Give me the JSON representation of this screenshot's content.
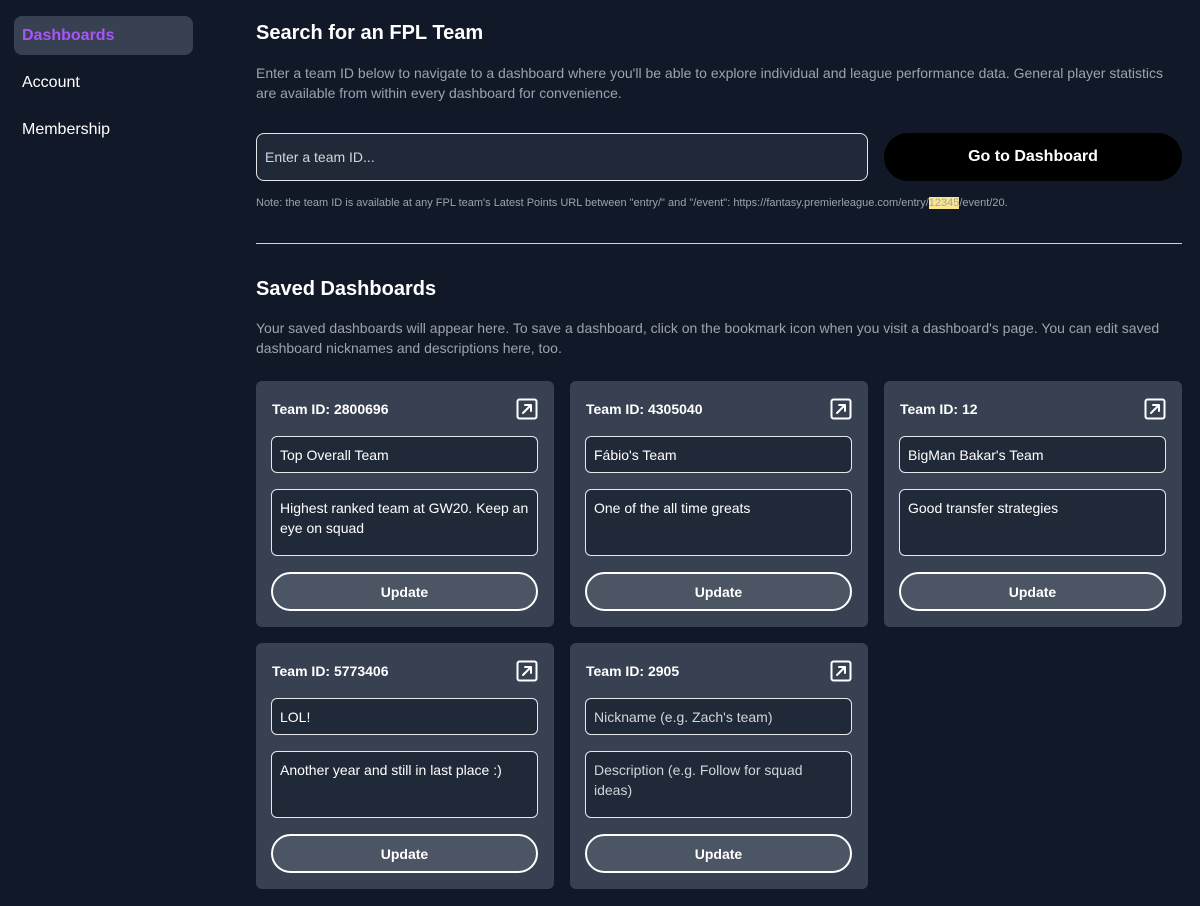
{
  "sidebar": {
    "items": [
      {
        "label": "Dashboards",
        "active": true
      },
      {
        "label": "Account",
        "active": false
      },
      {
        "label": "Membership",
        "active": false
      }
    ]
  },
  "search": {
    "title": "Search for an FPL Team",
    "description": "Enter a team ID below to navigate to a dashboard where you'll be able to explore individual and league performance data. General player statistics are available from within every dashboard for convenience.",
    "input_placeholder": "Enter a team ID...",
    "button_label": "Go to Dashboard",
    "note_prefix": "Note: the team ID is available at any FPL team's Latest Points URL between \"entry/\" and \"/event\": https://fantasy.premierleague.com/entry/",
    "note_highlight": "12345",
    "note_suffix": "/event/20."
  },
  "saved": {
    "title": "Saved Dashboards",
    "description": "Your saved dashboards will appear here. To save a dashboard, click on the bookmark icon when you visit a dashboard's page. You can edit saved dashboard nicknames and descriptions here, too.",
    "nickname_placeholder": "Nickname (e.g. Zach's team)",
    "description_placeholder": "Description (e.g. Follow for squad ideas)",
    "update_label": "Update",
    "cards": [
      {
        "title": "Team ID: 2800696",
        "nickname": "Top Overall Team",
        "description": "Highest ranked team at GW20. Keep an eye on squad"
      },
      {
        "title": "Team ID: 4305040",
        "nickname": "Fábio's Team",
        "description": "One of the all time greats"
      },
      {
        "title": "Team ID: 12",
        "nickname": "BigMan Bakar's Team",
        "description": "Good transfer strategies"
      },
      {
        "title": "Team ID: 5773406",
        "nickname": "LOL!",
        "description": "Another year and still in last place :)"
      },
      {
        "title": "Team ID: 2905",
        "nickname": "",
        "description": ""
      }
    ]
  },
  "colors": {
    "background": "#111827",
    "card": "#374151",
    "accent": "#a855f7",
    "highlight": "#fde68a"
  },
  "icons": {
    "card_open": "external-link-icon"
  }
}
